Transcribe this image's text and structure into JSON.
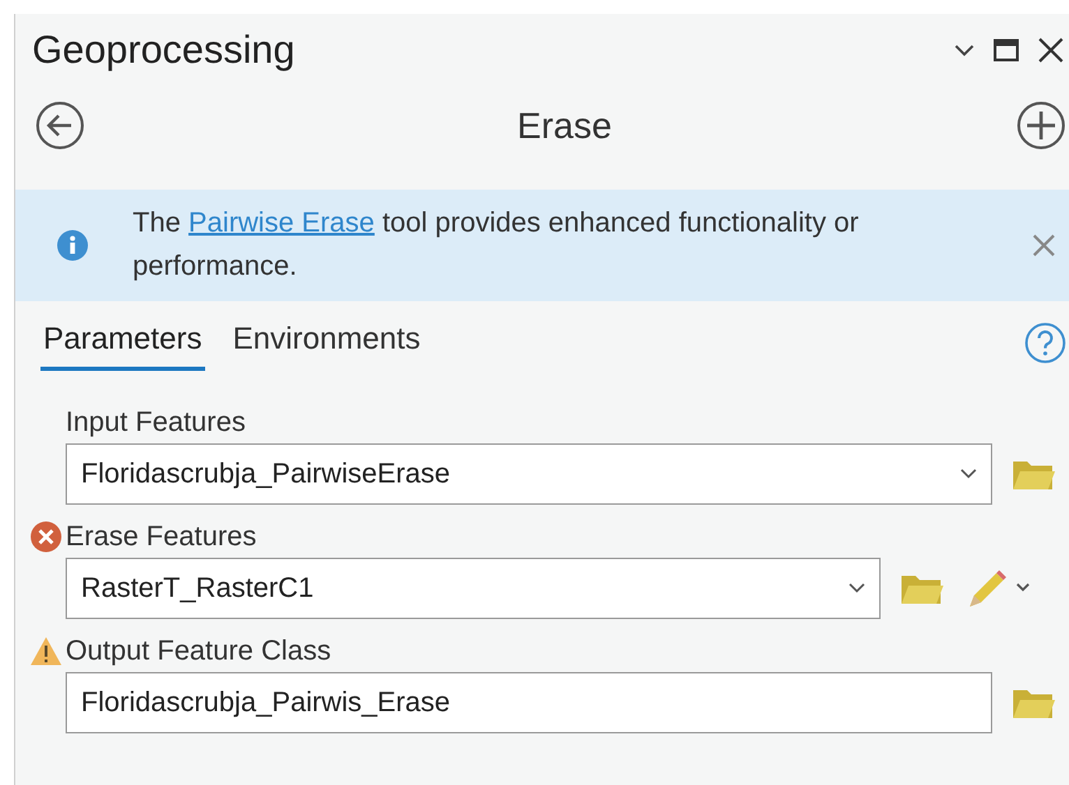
{
  "window": {
    "title": "Geoprocessing"
  },
  "tool": {
    "title": "Erase"
  },
  "banner": {
    "text": "The ",
    "link": "Pairwise Erase",
    "text_after": " tool provides enhanced functionality or performance."
  },
  "tabs": [
    {
      "label": "Parameters",
      "selected": true
    },
    {
      "label": "Environments",
      "selected": false
    }
  ],
  "parameters": [
    {
      "label": "Input Features",
      "value": "Floridascrubja_PairwiseErase",
      "kind": "dropdown",
      "error": false,
      "warning": false,
      "editor": false
    },
    {
      "label": "Erase Features",
      "value": "RasterT_RasterC1",
      "kind": "dropdown",
      "error": true,
      "warning": false,
      "editor": true
    },
    {
      "label": "Output Feature Class",
      "value": "Floridascrubja_Pairwis_Erase",
      "kind": "text",
      "error": false,
      "warning": true,
      "editor": false
    }
  ]
}
